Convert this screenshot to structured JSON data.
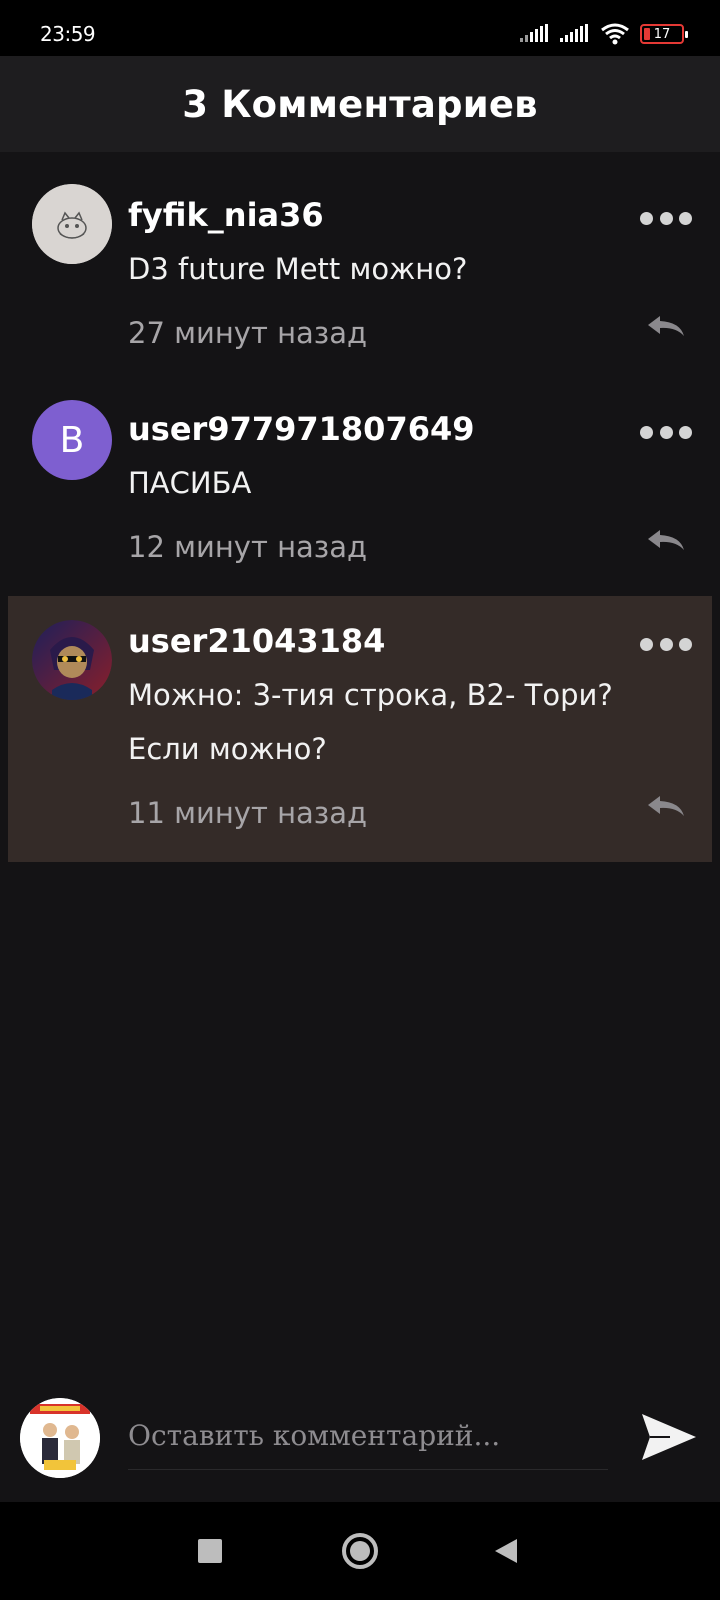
{
  "status_bar": {
    "time": "23:59",
    "battery_level": "17",
    "icons": [
      "signal-icon",
      "signal-icon",
      "wifi-icon",
      "battery-icon"
    ]
  },
  "header": {
    "title": "3 Комментариев"
  },
  "comments": [
    {
      "username": "fyfik_nia36",
      "text": "D3 future Mett можно?",
      "time_ago": "27 минут назад",
      "avatar_icon": "sketch-avatar-icon"
    },
    {
      "username": "user977971807649",
      "text": "ПАСИБА",
      "time_ago": "12 минут назад",
      "avatar_letter": "B",
      "avatar_color": "#7e5fd0"
    },
    {
      "username": "user21043184",
      "text_line1": "Можно: 3-тия строка, В2- Тори?",
      "text_line2": "Если можно?",
      "time_ago": "11 минут назад",
      "avatar_icon": "character-avatar-icon",
      "highlighted": true
    }
  ],
  "composer": {
    "placeholder": "Оставить комментарий...",
    "send_icon": "send-icon"
  },
  "navigation": {
    "buttons": [
      "recents-square-icon",
      "home-circle-icon",
      "back-triangle-icon"
    ]
  },
  "colors": {
    "background": "#141315",
    "header": "#1e1d1f",
    "highlight": "#342b28",
    "battery_low": "#e53935"
  }
}
